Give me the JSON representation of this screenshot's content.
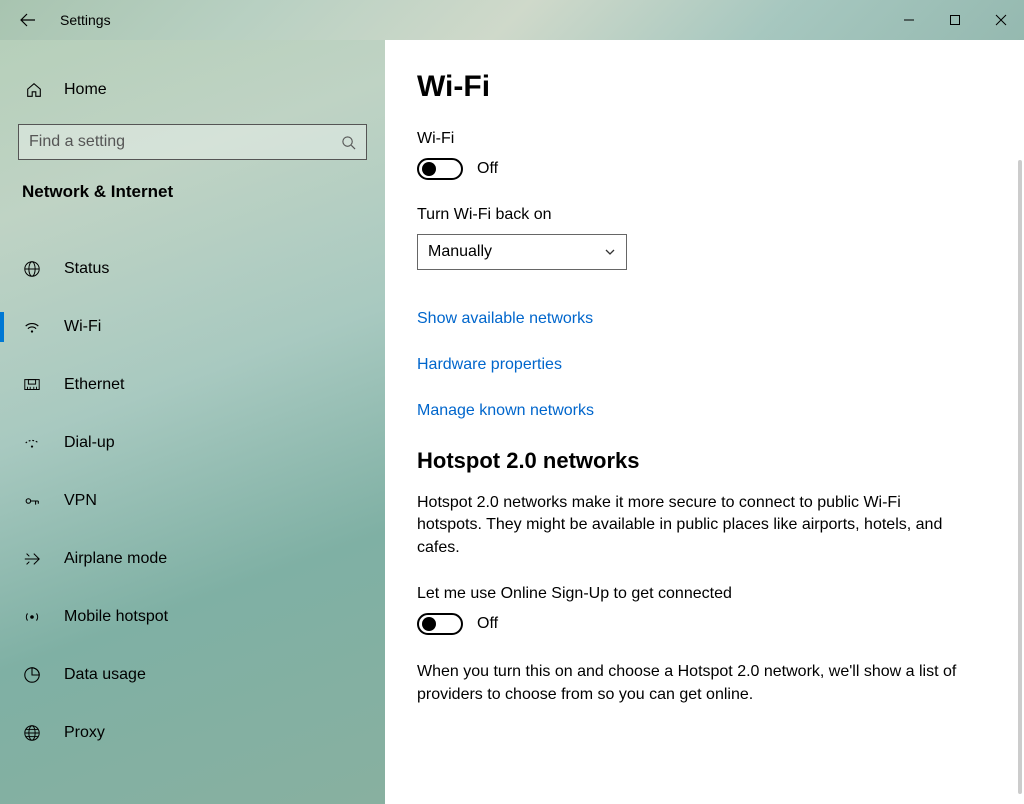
{
  "window": {
    "title": "Settings"
  },
  "sidebar": {
    "home_label": "Home",
    "search_placeholder": "Find a setting",
    "category": "Network & Internet",
    "items": [
      {
        "icon": "globe-grid-icon",
        "label": "Status",
        "selected": false
      },
      {
        "icon": "wifi-icon",
        "label": "Wi-Fi",
        "selected": true
      },
      {
        "icon": "ethernet-icon",
        "label": "Ethernet",
        "selected": false
      },
      {
        "icon": "dialup-icon",
        "label": "Dial-up",
        "selected": false
      },
      {
        "icon": "vpn-icon",
        "label": "VPN",
        "selected": false
      },
      {
        "icon": "airplane-icon",
        "label": "Airplane mode",
        "selected": false
      },
      {
        "icon": "hotspot-icon",
        "label": "Mobile hotspot",
        "selected": false
      },
      {
        "icon": "data-usage-icon",
        "label": "Data usage",
        "selected": false
      },
      {
        "icon": "proxy-icon",
        "label": "Proxy",
        "selected": false
      }
    ]
  },
  "content": {
    "page_title": "Wi-Fi",
    "wifi_label": "Wi-Fi",
    "wifi_state": "Off",
    "turn_on_label": "Turn Wi-Fi back on",
    "turn_on_value": "Manually",
    "links": {
      "show_networks": "Show available networks",
      "hardware_props": "Hardware properties",
      "known_networks": "Manage known networks"
    },
    "hotspot": {
      "title": "Hotspot 2.0 networks",
      "description": "Hotspot 2.0 networks make it more secure to connect to public Wi-Fi hotspots. They might be available in public places like airports, hotels, and cafes.",
      "signup_label": "Let me use Online Sign-Up to get connected",
      "signup_state": "Off",
      "signup_note": "When you turn this on and choose a Hotspot 2.0 network, we'll show a list of providers to choose from so you can get online."
    }
  }
}
